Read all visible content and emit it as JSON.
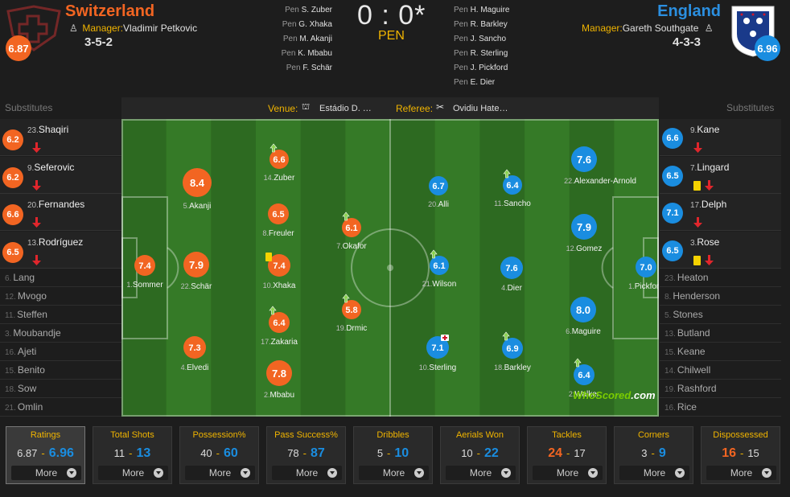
{
  "header": {
    "home": {
      "name": "Switzerland",
      "rating": "6.87",
      "manager_label": "Manager:",
      "manager": "Vladimir Petkovic",
      "formation": "3-5-2",
      "color": "#f26522"
    },
    "away": {
      "name": "England",
      "rating": "6.96",
      "manager_label": "Manager:",
      "manager": "Gareth Southgate",
      "formation": "4-3-3",
      "color": "#2b8fe0"
    },
    "score": "0 : 0*",
    "status": "PEN",
    "home_pens": [
      {
        "label": "Pen",
        "name": "S. Zuber"
      },
      {
        "label": "Pen",
        "name": "G. Xhaka"
      },
      {
        "label": "Pen",
        "name": "M. Akanji"
      },
      {
        "label": "Pen",
        "name": "K. Mbabu"
      },
      {
        "label": "Pen",
        "name": "F. Schär"
      }
    ],
    "away_pens": [
      {
        "label": "Pen",
        "name": "H. Maguire"
      },
      {
        "label": "Pen",
        "name": "R. Barkley"
      },
      {
        "label": "Pen",
        "name": "J. Sancho"
      },
      {
        "label": "Pen",
        "name": "R. Sterling"
      },
      {
        "label": "Pen",
        "name": "J. Pickford"
      },
      {
        "label": "Pen",
        "name": "E. Dier"
      }
    ]
  },
  "match_info": {
    "venue_label": "Venue:",
    "venue": "Estádio D. …",
    "referee_label": "Referee:",
    "referee": "Ovidiu Hate…"
  },
  "subs_label": "Substitutes",
  "home_subs_used": [
    {
      "num": "23.",
      "name": "Shaqiri",
      "rating": "6.2",
      "card": ""
    },
    {
      "num": "9.",
      "name": "Seferovic",
      "rating": "6.2",
      "card": ""
    },
    {
      "num": "20.",
      "name": "Fernandes",
      "rating": "6.6",
      "card": ""
    },
    {
      "num": "13.",
      "name": "Rodríguez",
      "rating": "6.5",
      "card": ""
    }
  ],
  "home_subs_unused": [
    {
      "num": "6.",
      "name": "Lang"
    },
    {
      "num": "12.",
      "name": "Mvogo"
    },
    {
      "num": "11.",
      "name": "Steffen"
    },
    {
      "num": "3.",
      "name": "Moubandje"
    },
    {
      "num": "16.",
      "name": "Ajeti"
    },
    {
      "num": "15.",
      "name": "Benito"
    },
    {
      "num": "18.",
      "name": "Sow"
    },
    {
      "num": "21.",
      "name": "Omlin"
    }
  ],
  "away_subs_used": [
    {
      "num": "9.",
      "name": "Kane",
      "rating": "6.6",
      "card": ""
    },
    {
      "num": "7.",
      "name": "Lingard",
      "rating": "6.5",
      "card": "yellow"
    },
    {
      "num": "17.",
      "name": "Delph",
      "rating": "7.1",
      "card": ""
    },
    {
      "num": "3.",
      "name": "Rose",
      "rating": "6.5",
      "card": "yellow"
    }
  ],
  "away_subs_unused": [
    {
      "num": "23.",
      "name": "Heaton"
    },
    {
      "num": "8.",
      "name": "Henderson"
    },
    {
      "num": "5.",
      "name": "Stones"
    },
    {
      "num": "13.",
      "name": "Butland"
    },
    {
      "num": "15.",
      "name": "Keane"
    },
    {
      "num": "14.",
      "name": "Chilwell"
    },
    {
      "num": "19.",
      "name": "Rashford"
    },
    {
      "num": "16.",
      "name": "Rice"
    }
  ],
  "home_players": [
    {
      "num": "1.",
      "name": "Sommer",
      "rating": "7.4",
      "sub": false,
      "card": ""
    },
    {
      "num": "22.",
      "name": "Schär",
      "rating": "7.9",
      "sub": false,
      "card": ""
    },
    {
      "num": "5.",
      "name": "Akanji",
      "rating": "8.4",
      "sub": false,
      "card": ""
    },
    {
      "num": "4.",
      "name": "Elvedi",
      "rating": "7.3",
      "sub": false,
      "card": ""
    },
    {
      "num": "14.",
      "name": "Zuber",
      "rating": "6.6",
      "sub": true,
      "card": ""
    },
    {
      "num": "8.",
      "name": "Freuler",
      "rating": "6.5",
      "sub": false,
      "card": ""
    },
    {
      "num": "10.",
      "name": "Xhaka",
      "rating": "7.4",
      "sub": false,
      "card": "yellow"
    },
    {
      "num": "17.",
      "name": "Zakaria",
      "rating": "6.4",
      "sub": true,
      "card": ""
    },
    {
      "num": "2.",
      "name": "Mbabu",
      "rating": "7.8",
      "sub": false,
      "card": ""
    },
    {
      "num": "7.",
      "name": "Okafor",
      "rating": "6.1",
      "sub": true,
      "card": ""
    },
    {
      "num": "19.",
      "name": "Drmic",
      "rating": "5.8",
      "sub": true,
      "card": ""
    }
  ],
  "away_players": [
    {
      "num": "1.",
      "name": "Pickford",
      "rating": "7.0",
      "sub": false,
      "card": ""
    },
    {
      "num": "22.",
      "name": "Alexander-Arnold",
      "rating": "7.6",
      "sub": false,
      "card": ""
    },
    {
      "num": "12.",
      "name": "Gomez",
      "rating": "7.9",
      "sub": false,
      "card": ""
    },
    {
      "num": "6.",
      "name": "Maguire",
      "rating": "8.0",
      "sub": false,
      "card": ""
    },
    {
      "num": "2.",
      "name": "Walker",
      "rating": "6.4",
      "sub": true,
      "card": ""
    },
    {
      "num": "4.",
      "name": "Dier",
      "rating": "7.6",
      "sub": false,
      "card": ""
    },
    {
      "num": "11.",
      "name": "Sancho",
      "rating": "6.4",
      "sub": true,
      "card": ""
    },
    {
      "num": "18.",
      "name": "Barkley",
      "rating": "6.9",
      "sub": true,
      "card": ""
    },
    {
      "num": "20.",
      "name": "Alli",
      "rating": "6.7",
      "sub": false,
      "card": ""
    },
    {
      "num": "21.",
      "name": "Wilson",
      "rating": "6.1",
      "sub": true,
      "card": ""
    },
    {
      "num": "10.",
      "name": "Sterling",
      "rating": "7.1",
      "sub": false,
      "card": "injury"
    }
  ],
  "stats": [
    {
      "title": "Ratings",
      "home": "6.87",
      "away": "6.96",
      "more": "More",
      "active": true,
      "lead": "away"
    },
    {
      "title": "Total Shots",
      "home": "11",
      "away": "13",
      "more": "More",
      "active": false,
      "lead": "away"
    },
    {
      "title": "Possession%",
      "home": "40",
      "away": "60",
      "more": "More",
      "active": false,
      "lead": "away"
    },
    {
      "title": "Pass Success%",
      "home": "78",
      "away": "87",
      "more": "More",
      "active": false,
      "lead": "away"
    },
    {
      "title": "Dribbles",
      "home": "5",
      "away": "10",
      "more": "More",
      "active": false,
      "lead": "away"
    },
    {
      "title": "Aerials Won",
      "home": "10",
      "away": "22",
      "more": "More",
      "active": false,
      "lead": "away"
    },
    {
      "title": "Tackles",
      "home": "24",
      "away": "17",
      "more": "More",
      "active": false,
      "lead": "home"
    },
    {
      "title": "Corners",
      "home": "3",
      "away": "9",
      "more": "More",
      "active": false,
      "lead": "away"
    },
    {
      "title": "Dispossessed",
      "home": "16",
      "away": "15",
      "more": "More",
      "active": false,
      "lead": "home"
    }
  ],
  "watermark": {
    "a": "WhoScored",
    "b": ".com"
  },
  "colors": {
    "home": "#f26522",
    "away": "#1a8de0",
    "pitch_dark": "#2d6a21",
    "pitch_light": "#357a27",
    "yellow": "#f0b400",
    "accent": "#f0b400"
  }
}
